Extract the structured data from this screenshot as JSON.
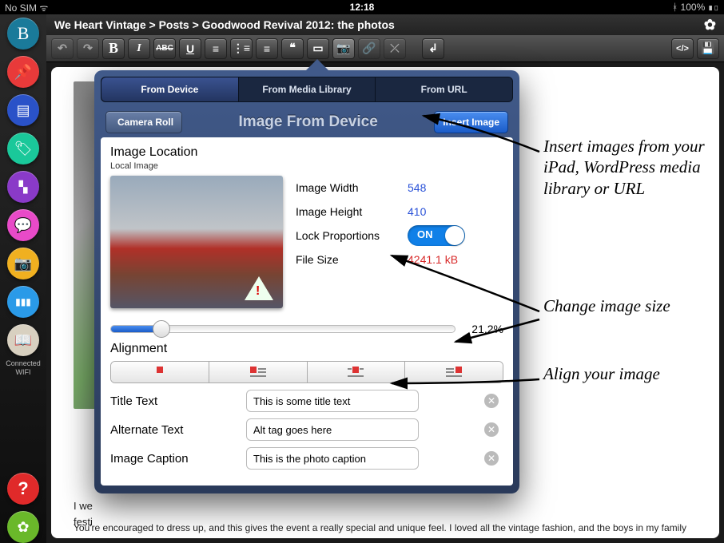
{
  "status": {
    "sim": "No SIM",
    "wifi_icon": "wifi",
    "time": "12:18",
    "bt_icon": "bluetooth",
    "battery": "100%"
  },
  "sidebar": {
    "items": [
      {
        "name": "blog",
        "glyph": "B",
        "bg": "#1a7a9a"
      },
      {
        "name": "pin",
        "glyph": "•",
        "bg": "#e83a3a"
      },
      {
        "name": "pages",
        "glyph": "▤",
        "bg": "#2a52c8"
      },
      {
        "name": "tags",
        "glyph": "⊘",
        "bg": "#1ac89a"
      },
      {
        "name": "sitemap",
        "glyph": "⊞",
        "bg": "#8a3ac8"
      },
      {
        "name": "comments",
        "glyph": "●",
        "bg": "#e84ac8"
      },
      {
        "name": "camera",
        "glyph": "◉",
        "bg": "#f0b020"
      },
      {
        "name": "stats",
        "glyph": "▮▮▮",
        "bg": "#2a9ae8"
      },
      {
        "name": "wifi",
        "glyph": "▣",
        "bg": "#d8d0c0"
      }
    ],
    "wifi_label_1": "Connected",
    "wifi_label_2": "WIFI",
    "help": {
      "glyph": "?",
      "bg": "#e02a2a"
    },
    "settings": {
      "glyph": "✿",
      "bg": "#6ab82a"
    }
  },
  "breadcrumb": "We Heart Vintage > Posts > Goodwood Revival 2012: the photos",
  "editor": {
    "snippet_left": "I we",
    "snippet_left2": "festi",
    "snippet_bottom": "You're encouraged to dress up, and this gives the event a really special and unique feel. I loved all the vintage fashion, and the boys in my family"
  },
  "popover": {
    "tabs": [
      "From Device",
      "From Media Library",
      "From URL"
    ],
    "back": "Camera Roll",
    "title": "Image From Device",
    "insert": "Insert Image",
    "section": "Image Location",
    "subsection": "Local Image",
    "props": {
      "width_k": "Image Width",
      "width_v": "548",
      "height_k": "Image Height",
      "height_v": "410",
      "lock_k": "Lock Proportions",
      "lock_v": "ON",
      "size_k": "File Size",
      "size_v": "4241.1 kB"
    },
    "slider_pct": "21.2%",
    "alignment_label": "Alignment",
    "fields": {
      "title_k": "Title Text",
      "title_v": "This is some title text",
      "alt_k": "Alternate Text",
      "alt_v": "Alt tag goes here",
      "cap_k": "Image Caption",
      "cap_v": "This is the photo caption"
    }
  },
  "annotations": {
    "a1": "Insert images from your iPad, WordPress media library or URL",
    "a2": "Change image size",
    "a3": "Align your image"
  }
}
